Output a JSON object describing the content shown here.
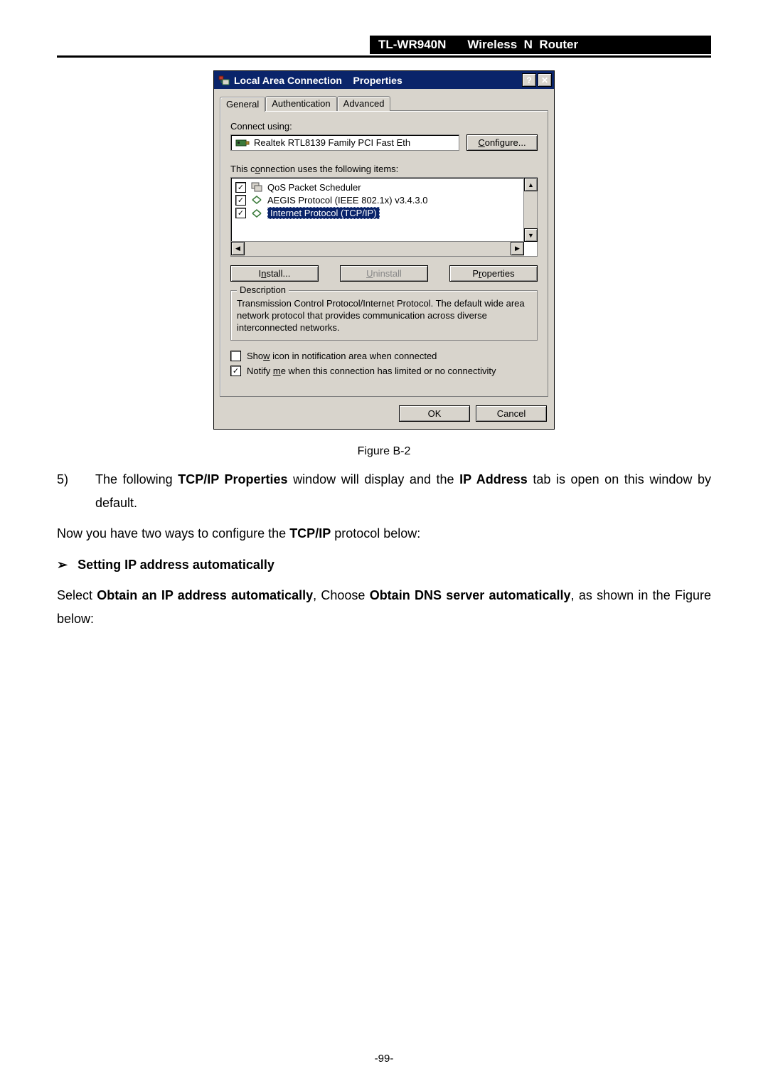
{
  "header": {
    "model": "TL-WR940N",
    "product": "Wireless  N  Router"
  },
  "dialog": {
    "title": "Local Area Connection    Properties",
    "tabs": {
      "general": "General",
      "auth": "Authentication",
      "advanced": "Advanced"
    },
    "connect_label": "Connect using:",
    "nic": "Realtek RTL8139 Family PCI Fast Eth",
    "configure": "Configure...",
    "items_label": "This connection uses the following items:",
    "items": [
      {
        "label": "QoS Packet Scheduler",
        "checked": true
      },
      {
        "label": "AEGIS Protocol (IEEE 802.1x) v3.4.3.0",
        "checked": true
      },
      {
        "label": "Internet Protocol (TCP/IP)",
        "checked": true,
        "selected": true
      }
    ],
    "install": "Install...",
    "uninstall": "Uninstall",
    "properties": "Properties",
    "desc_legend": "Description",
    "desc_text": "Transmission Control Protocol/Internet Protocol. The default wide area network protocol that provides communication across diverse interconnected networks.",
    "cb_show": "Show icon in notification area when connected",
    "cb_notify": "Notify me when this connection has limited or no connectivity",
    "ok": "OK",
    "cancel": "Cancel"
  },
  "caption": "Figure B-2",
  "step": {
    "num": "5)",
    "t1": "The following ",
    "b1": "TCP/IP Properties",
    "t2": " window will display and the ",
    "b2": "IP Address",
    "t3": " tab is open on this window by default."
  },
  "para1": {
    "t1": "Now you have two ways to configure the ",
    "b1": "TCP/IP",
    "t2": " protocol below:"
  },
  "arrow_heading": "Setting IP address automatically",
  "para2": {
    "t1": "Select ",
    "b1": "Obtain an IP address automatically",
    "t2": ", Choose ",
    "b2": "Obtain DNS server automatically",
    "t3": ", as shown in the Figure below:"
  },
  "pagenum": "-99-"
}
